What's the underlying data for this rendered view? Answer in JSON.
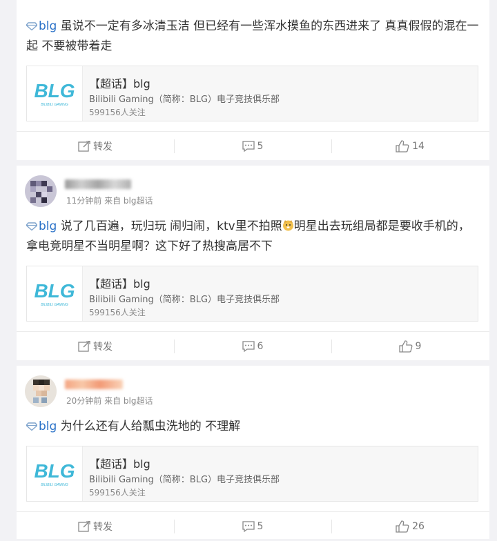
{
  "posts": [
    {
      "text_before": "blg",
      "text": " 虽说不一定有多冰清玉洁 但已经有一些浑水摸鱼的东西进来了 真真假假的混在一起 不要被带着走",
      "card": {
        "title": "【超话】blg",
        "subtitle": "Bilibili Gaming（简称：BLG）电子竞技俱乐部",
        "fans": "599156人关注"
      },
      "actions": {
        "repost": "转发",
        "comments": "5",
        "likes": "14"
      }
    },
    {
      "author": "",
      "meta": "11分钟前 来自 blg超话",
      "text_before": "blg",
      "text": " 说了几百遍，玩归玩 闹归闹，ktv里不拍照",
      "text_after": "明星出去玩组局都是要收手机的，拿电竞明星不当明星啊？这下好了热搜高居不下",
      "card": {
        "title": "【超话】blg",
        "subtitle": "Bilibili Gaming（简称：BLG）电子竞技俱乐部",
        "fans": "599156人关注"
      },
      "actions": {
        "repost": "转发",
        "comments": "6",
        "likes": "9"
      }
    },
    {
      "author": "",
      "meta": "20分钟前 来自 blg超话",
      "text_before": "blg",
      "text": " 为什么还有人给瓢虫洗地的 不理解",
      "card": {
        "title": "【超话】blg",
        "subtitle": "Bilibili Gaming（简称：BLG）电子竞技俱乐部",
        "fans": "599156人关注"
      },
      "actions": {
        "repost": "转发",
        "comments": "5",
        "likes": "26"
      }
    }
  ],
  "logo_text": "BLG",
  "logo_subtext": "BILIBILI GAMING",
  "colors": {
    "accent": "#2b72c8",
    "logo": "#3fb8d8"
  }
}
